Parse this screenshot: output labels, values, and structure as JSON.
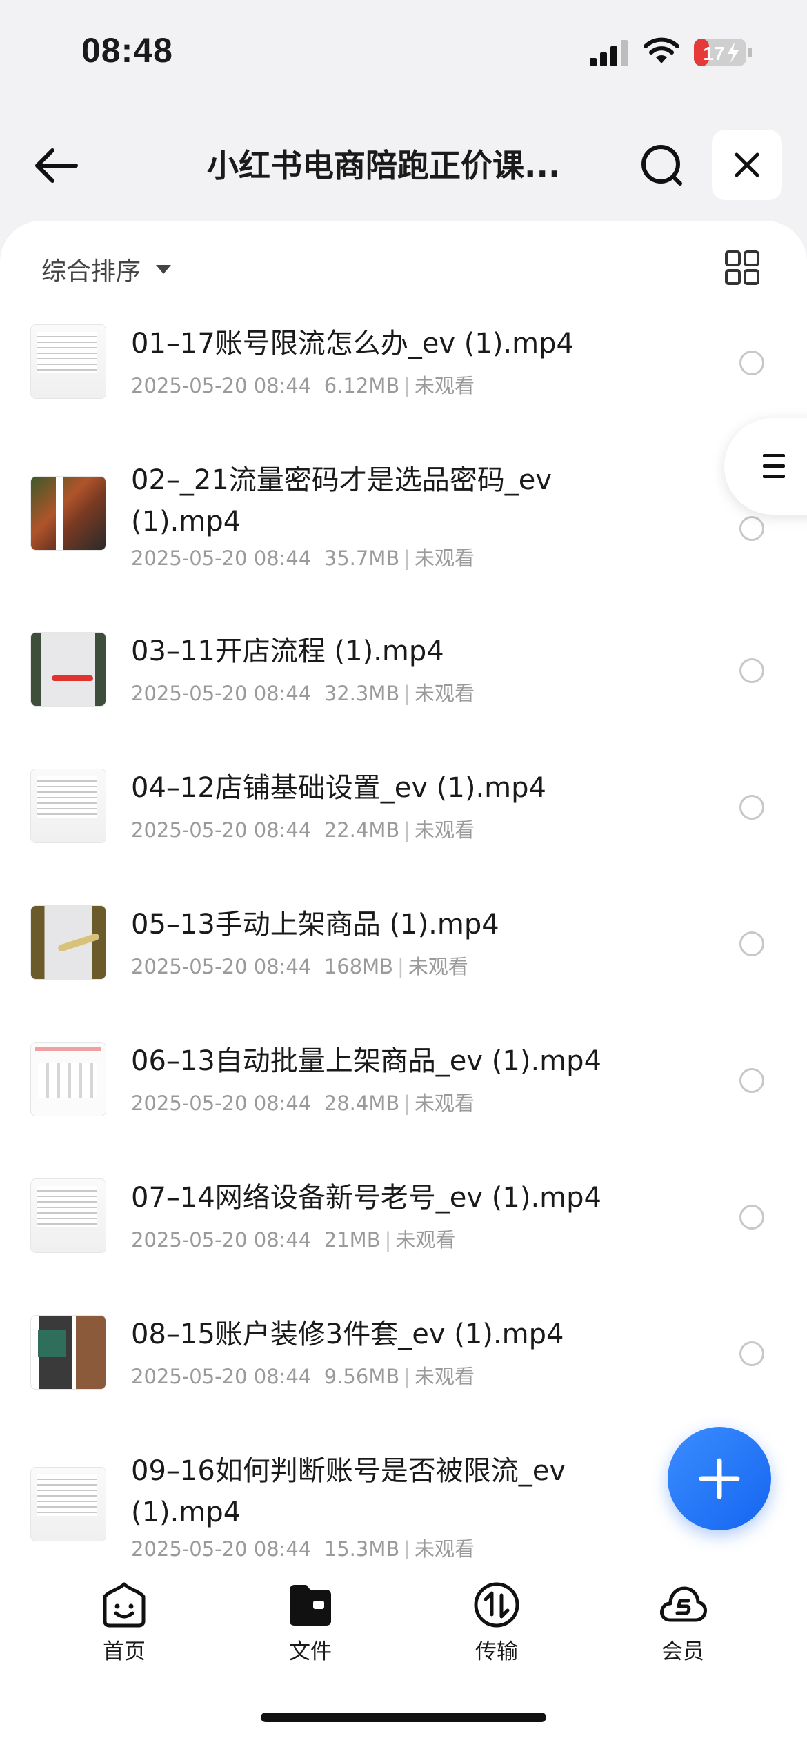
{
  "status_bar": {
    "time": "08:48",
    "battery_level": "17"
  },
  "header": {
    "title": "小红书电商陪跑正价课..."
  },
  "toolbar": {
    "sort_label": "综合排序"
  },
  "files": [
    {
      "name": "01–17账号限流怎么办_ev (1).mp4",
      "date": "2025-05-20 08:44",
      "size": "6.12MB",
      "status": "未观看"
    },
    {
      "name": "02–_21流量密码才是选品密码_ev (1).mp4",
      "date": "2025-05-20 08:44",
      "size": "35.7MB",
      "status": "未观看"
    },
    {
      "name": "03–11开店流程 (1).mp4",
      "date": "2025-05-20 08:44",
      "size": "32.3MB",
      "status": "未观看"
    },
    {
      "name": "04–12店铺基础设置_ev (1).mp4",
      "date": "2025-05-20 08:44",
      "size": "22.4MB",
      "status": "未观看"
    },
    {
      "name": "05–13手动上架商品 (1).mp4",
      "date": "2025-05-20 08:44",
      "size": "168MB",
      "status": "未观看"
    },
    {
      "name": "06–13自动批量上架商品_ev (1).mp4",
      "date": "2025-05-20 08:44",
      "size": "28.4MB",
      "status": "未观看"
    },
    {
      "name": "07–14网络设备新号老号_ev (1).mp4",
      "date": "2025-05-20 08:44",
      "size": "21MB",
      "status": "未观看"
    },
    {
      "name": "08–15账户装修3件套_ev (1).mp4",
      "date": "2025-05-20 08:44",
      "size": "9.56MB",
      "status": "未观看"
    },
    {
      "name": "09–16如何判断账号是否被限流_ev (1).mp4",
      "date": "2025-05-20 08:44",
      "size": "15.3MB",
      "status": "未观看"
    }
  ],
  "tab_bar": {
    "home": "首页",
    "files": "文件",
    "transfer": "传输",
    "vip": "会员"
  }
}
